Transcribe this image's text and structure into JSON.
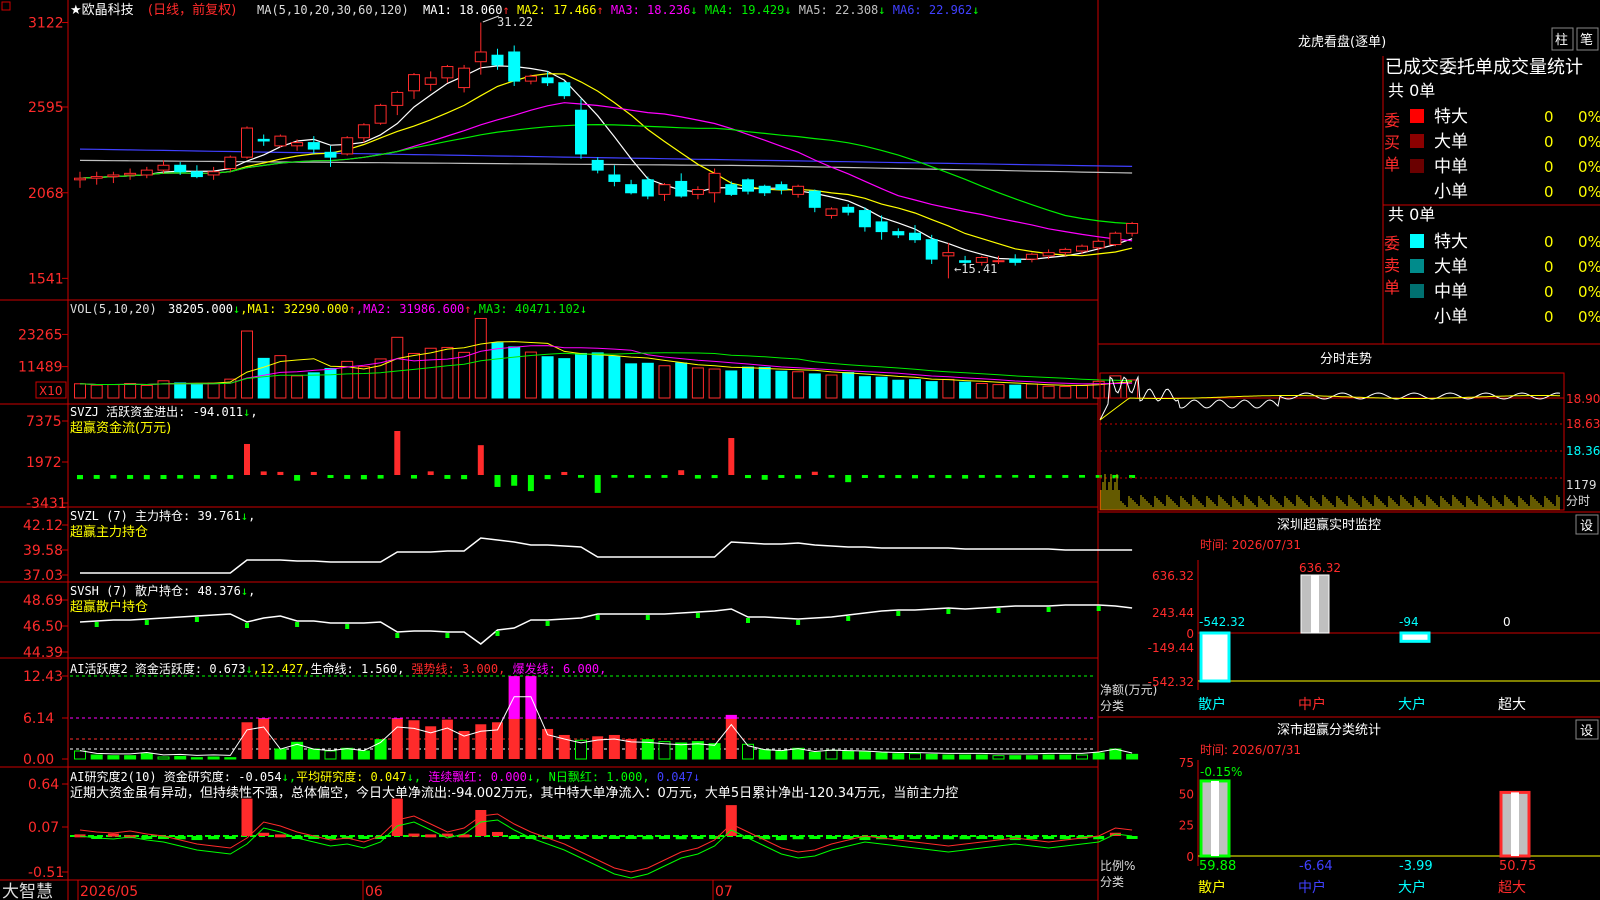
{
  "app": {
    "brand": "大智慧",
    "stock_title": "★欧晶科技",
    "mode_label": "(日线，前复权)"
  },
  "colors": {
    "up": "#ff2b2b",
    "down": "#00ffff",
    "axis": "#cc0000",
    "white": "#ffffff",
    "yellow": "#ffff00",
    "magenta": "#ff00ff",
    "green": "#00ee00",
    "blue": "#4040ff",
    "gray": "#c0c0c0",
    "bright_green": "#00ff00"
  },
  "price_panel": {
    "ma_label": "MA(5,10,20,30,60,120)",
    "ma_values": [
      {
        "label": "MA1:",
        "value": "18.060",
        "arrow": "↑",
        "color": "#ffffff"
      },
      {
        "label": "MA2:",
        "value": "17.466",
        "arrow": "↑",
        "color": "#ffff00"
      },
      {
        "label": "MA3:",
        "value": "18.236",
        "arrow": "↓",
        "color": "#ff00ff"
      },
      {
        "label": "MA4:",
        "value": "19.429",
        "arrow": "↓",
        "color": "#00ee00"
      },
      {
        "label": "MA5:",
        "value": "22.308",
        "arrow": "↓",
        "color": "#c0c0c0"
      },
      {
        "label": "MA6:",
        "value": "22.962",
        "arrow": "↓",
        "color": "#4040ff"
      }
    ],
    "y_ticks": [
      "3122",
      "2595",
      "2068",
      "1541"
    ],
    "high_label": "31.22",
    "low_label": "←15.41"
  },
  "volume_panel": {
    "label": "VOL(5,10,20)",
    "value": "38205.000",
    "value_arrow": "↓",
    "ma_values": [
      {
        "label": "MA1:",
        "value": "32290.000",
        "arrow": "↑",
        "color": "#ffff00"
      },
      {
        "label": "MA2:",
        "value": "31986.600",
        "arrow": "↑",
        "color": "#ff00ff"
      },
      {
        "label": "MA3:",
        "value": "40471.102",
        "arrow": "↓",
        "color": "#00ee00"
      }
    ],
    "y_ticks": [
      "23265",
      "11489"
    ],
    "unit_badge": "X10"
  },
  "svzj_panel": {
    "label": "SVZJ  活跃资金进出:",
    "value": "-94.011",
    "arrow": "↓",
    "subtitle": "超赢资金流(万元)",
    "y_ticks": [
      "7375",
      "1972",
      "-3431"
    ]
  },
  "svzl_panel": {
    "label": "SVZL (7) 主力持仓:",
    "value": "39.761",
    "arrow": "↓",
    "subtitle": "超赢主力持仓",
    "y_ticks": [
      "42.12",
      "39.58",
      "37.03"
    ]
  },
  "svsh_panel": {
    "label": "SVSH (7) 散户持仓:",
    "value": "48.376",
    "arrow": "↓",
    "subtitle": "超赢散户持仓",
    "y_ticks": [
      "48.69",
      "46.50",
      "44.39"
    ]
  },
  "ai_activity_panel": {
    "label": "AI活跃度2 资金活跃度:",
    "value": "0.673",
    "arrow": "↓",
    "value2": "12.427",
    "life_line_label": "生命线:",
    "life_line_value": "1.560",
    "strong_line": "强势线: 3.000",
    "burst_line": "爆发线: 6.000",
    "y_ticks": [
      "12.43",
      "6.14",
      "0.00"
    ]
  },
  "ai_research_panel": {
    "label": "AI研究度2(10) 资金研究度:",
    "value": "-0.054",
    "arrow": "↓",
    "avg_label": "平均研究度:",
    "avg_value": "0.047",
    "avg_arrow": "↓",
    "streak_label": "连续飘红:",
    "streak_value": "0.000",
    "streak_arrow": "↓",
    "nday_label": "N日飘红:",
    "nday_value": "1.000",
    "tail_value": "0.047",
    "tail_arrow": "↓",
    "commentary": "近期大资金虽有异动，但持续性不强，总体偏空，今日大单净流出:-94.002万元，其中特大单净流入：0万元，大单5日累计净出-120.34万元，当前主力控",
    "y_ticks": [
      "0.64",
      "0.07",
      "-0.51"
    ]
  },
  "x_axis": {
    "labels": [
      "2026/05",
      "06",
      "07"
    ]
  },
  "dragon_tiger": {
    "title": "龙虎看盘(逐单)",
    "btn_bar": "柱",
    "btn_stroke": "笔",
    "header": "已成交委托单成交量统计",
    "buy_group_label": "委买单",
    "sell_group_label": "委卖单",
    "buy_total": "共 0单",
    "sell_total": "共 0单",
    "buy_rows": [
      {
        "name": "特大",
        "count": "0",
        "pct": "0%",
        "color": "#ff0000"
      },
      {
        "name": "大单",
        "count": "0",
        "pct": "0%",
        "color": "#8b0000"
      },
      {
        "name": "中单",
        "count": "0",
        "pct": "0%",
        "color": "#6a0000"
      },
      {
        "name": "小单",
        "count": "0",
        "pct": "0%",
        "color": ""
      }
    ],
    "sell_rows": [
      {
        "name": "特大",
        "count": "0",
        "pct": "0%",
        "color": "#00ffff"
      },
      {
        "name": "大单",
        "count": "0",
        "pct": "0%",
        "color": "#008b8b"
      },
      {
        "name": "中单",
        "count": "0",
        "pct": "0%",
        "color": "#007070"
      },
      {
        "name": "小单",
        "count": "0",
        "pct": "0%",
        "color": ""
      }
    ]
  },
  "intraday": {
    "title": "分时走势",
    "price_ticks": [
      "18.90",
      "18.63",
      "18.36"
    ],
    "vol_tick": "1179",
    "vol_label": "分时"
  },
  "shenzhen_monitor": {
    "title": "深圳超赢实时监控",
    "settings_btn": "设",
    "time_label": "时间: 2026/07/31",
    "y_ticks": [
      "636.32",
      "243.44",
      "0",
      "-149.44",
      "-542.32"
    ],
    "net_label": "净额(万元)",
    "category_label": "分类",
    "bars": [
      {
        "name": "散户",
        "value": -542.32,
        "label": "-542.32",
        "name_color": "#00ffff"
      },
      {
        "name": "中户",
        "value": 636.32,
        "label": "636.32",
        "name_color": "#ff2b2b"
      },
      {
        "name": "大户",
        "value": -94,
        "label": "-94",
        "name_color": "#00ffff"
      },
      {
        "name": "超大",
        "value": 0,
        "label": "0",
        "name_color": "#ffffff"
      }
    ]
  },
  "market_category": {
    "title": "深市超赢分类统计",
    "settings_btn": "设",
    "time_label": "时间: 2026/07/31",
    "y_ticks": [
      "75",
      "50",
      "25",
      "0"
    ],
    "ratio_label": "比例%",
    "category_label": "分类",
    "top_label": "-0.15%",
    "bars": [
      {
        "name": "散户",
        "value": 59.88,
        "label": "59.88",
        "name_color": "#ffff00",
        "label_color": "#00ff00"
      },
      {
        "name": "中户",
        "value": -6.64,
        "label": "-6.64",
        "name_color": "#4040ff",
        "label_color": "#4040ff"
      },
      {
        "name": "大户",
        "value": -3.99,
        "label": "-3.99",
        "name_color": "#00ffff",
        "label_color": "#00ffff"
      },
      {
        "name": "超大",
        "value": 50.75,
        "label": "50.75",
        "name_color": "#ff2b2b",
        "label_color": "#ff2b2b"
      }
    ]
  },
  "chart_data": [
    {
      "type": "candlestick",
      "title": "欧晶科技",
      "ylim": [
        15.0,
        31.5
      ],
      "ohlc": [
        [
          21.5,
          22.0,
          21.0,
          21.6
        ],
        [
          21.6,
          22.0,
          21.2,
          21.7
        ],
        [
          21.7,
          22.0,
          21.3,
          21.8
        ],
        [
          21.8,
          22.2,
          21.5,
          21.9
        ],
        [
          21.8,
          22.3,
          21.6,
          22.1
        ],
        [
          22.1,
          22.7,
          21.9,
          22.4
        ],
        [
          22.4,
          22.6,
          21.8,
          22.0
        ],
        [
          22.0,
          22.4,
          21.6,
          21.7
        ],
        [
          21.8,
          22.3,
          21.5,
          22.0
        ],
        [
          22.2,
          23.0,
          22.0,
          22.9
        ],
        [
          22.9,
          24.8,
          22.8,
          24.7
        ],
        [
          24.0,
          24.3,
          23.6,
          23.9
        ],
        [
          23.6,
          24.3,
          23.5,
          24.2
        ],
        [
          23.6,
          24.0,
          23.3,
          23.8
        ],
        [
          23.8,
          24.2,
          23.1,
          23.4
        ],
        [
          23.2,
          23.6,
          22.3,
          22.9
        ],
        [
          23.1,
          24.2,
          23.0,
          24.1
        ],
        [
          24.1,
          25.0,
          23.8,
          24.9
        ],
        [
          25.0,
          26.2,
          24.9,
          26.1
        ],
        [
          26.1,
          27.0,
          25.5,
          26.9
        ],
        [
          27.0,
          28.1,
          26.5,
          28.0
        ],
        [
          27.4,
          28.2,
          27.0,
          27.8
        ],
        [
          27.8,
          28.6,
          27.5,
          28.5
        ],
        [
          27.2,
          28.6,
          26.9,
          28.4
        ],
        [
          28.8,
          31.22,
          28.0,
          29.4
        ],
        [
          29.2,
          29.6,
          28.3,
          28.6
        ],
        [
          29.4,
          29.8,
          27.3,
          27.6
        ],
        [
          27.6,
          28.0,
          27.4,
          27.9
        ],
        [
          27.8,
          28.2,
          27.3,
          27.5
        ],
        [
          27.5,
          27.6,
          26.5,
          26.7
        ],
        [
          25.8,
          26.5,
          22.8,
          23.1
        ],
        [
          22.7,
          22.9,
          21.9,
          22.1
        ],
        [
          21.8,
          22.4,
          21.1,
          21.4
        ],
        [
          21.2,
          21.5,
          20.6,
          20.7
        ],
        [
          21.5,
          21.7,
          20.3,
          20.5
        ],
        [
          20.6,
          21.3,
          20.2,
          21.2
        ],
        [
          21.4,
          21.9,
          20.4,
          20.5
        ],
        [
          20.6,
          21.1,
          20.3,
          20.9
        ],
        [
          20.7,
          22.2,
          20.1,
          21.9
        ],
        [
          21.2,
          21.4,
          20.5,
          20.6
        ],
        [
          21.5,
          21.6,
          20.6,
          20.8
        ],
        [
          21.1,
          21.2,
          20.5,
          20.7
        ],
        [
          21.2,
          21.4,
          20.6,
          20.9
        ],
        [
          20.6,
          21.2,
          20.4,
          21.1
        ],
        [
          20.8,
          20.9,
          19.5,
          19.8
        ],
        [
          19.3,
          19.8,
          19.1,
          19.7
        ],
        [
          19.8,
          20.0,
          19.3,
          19.5
        ],
        [
          19.6,
          19.8,
          18.3,
          18.6
        ],
        [
          18.9,
          19.3,
          17.8,
          18.3
        ],
        [
          18.3,
          18.5,
          17.9,
          18.1
        ],
        [
          18.2,
          18.7,
          17.6,
          17.8
        ],
        [
          17.8,
          18.1,
          16.3,
          16.6
        ],
        [
          16.8,
          17.6,
          15.41,
          17.0
        ],
        [
          16.5,
          16.8,
          16.1,
          16.4
        ],
        [
          16.4,
          16.8,
          16.2,
          16.7
        ],
        [
          16.5,
          16.8,
          16.3,
          16.5
        ],
        [
          16.6,
          16.9,
          16.2,
          16.4
        ],
        [
          16.6,
          17.0,
          16.4,
          16.9
        ],
        [
          16.8,
          17.2,
          16.6,
          17.0
        ],
        [
          17.0,
          17.3,
          16.8,
          17.2
        ],
        [
          17.1,
          17.5,
          16.9,
          17.4
        ],
        [
          17.3,
          17.8,
          17.2,
          17.7
        ],
        [
          17.5,
          18.3,
          17.4,
          18.2
        ],
        [
          18.2,
          18.9,
          18.0,
          18.8
        ]
      ]
    },
    {
      "type": "bar",
      "title": "VOL",
      "ylim": [
        0,
        30000
      ],
      "values": [
        5200,
        4700,
        4900,
        5300,
        4600,
        6300,
        5500,
        5100,
        5400,
        6900,
        24500,
        14500,
        15500,
        8100,
        9200,
        10800,
        13400,
        11500,
        14300,
        22200,
        16300,
        18200,
        18500,
        16700,
        29100,
        20200,
        18700,
        16800,
        15100,
        14400,
        16300,
        16500,
        15200,
        12500,
        12700,
        11800,
        12800,
        11000,
        10600,
        9900,
        11300,
        11200,
        9800,
        9600,
        8800,
        8400,
        9300,
        7800,
        7600,
        6500,
        6700,
        6000,
        6800,
        5800,
        5300,
        4900,
        4700,
        5100,
        4300,
        4200,
        4600,
        6100,
        8100,
        6600
      ]
    },
    {
      "type": "bar",
      "title": "SVZJ",
      "ylim": [
        -3431,
        7375
      ],
      "values": [
        -700,
        -650,
        -600,
        -650,
        -720,
        -680,
        -600,
        -630,
        -650,
        -640,
        5200,
        600,
        520,
        -950,
        510,
        -500,
        -650,
        -720,
        -600,
        7375,
        -600,
        610,
        -650,
        -700,
        5000,
        -2000,
        -1800,
        -2700,
        -700,
        510,
        -460,
        -3000,
        -460,
        -450,
        -520,
        -480,
        800,
        -600,
        -520,
        6200,
        -520,
        -800,
        -500,
        -600,
        550,
        -450,
        -1200,
        -500,
        -480,
        -520,
        -560,
        -470,
        -520,
        -600,
        -480,
        -460,
        -440,
        -500,
        -520,
        -480,
        -450,
        -470,
        -560,
        -500
      ]
    }
  ]
}
